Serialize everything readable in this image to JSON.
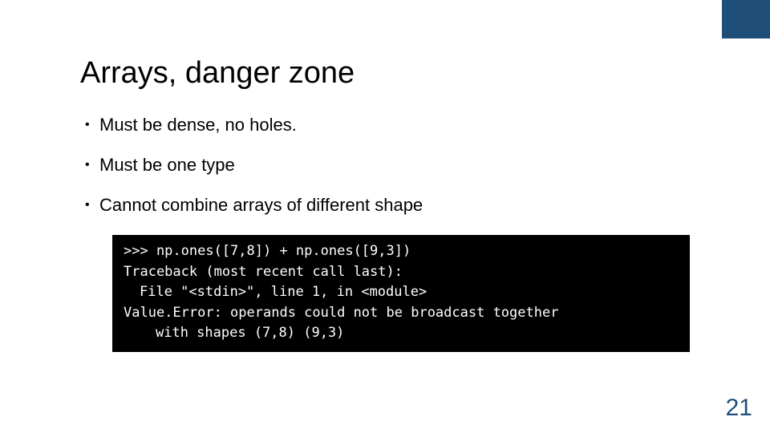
{
  "accent_color": "#1f4e79",
  "title": "Arrays, danger zone",
  "bullets": [
    "Must be dense, no holes.",
    "Must be one type",
    "Cannot combine arrays of different shape"
  ],
  "code": {
    "lines": [
      ">>> np.ones([7,8]) + np.ones([9,3])",
      "Traceback (most recent call last):",
      "File \"<stdin>\", line 1, in <module>",
      "Value.Error: operands could not be broadcast together",
      "with shapes (7,8) (9,3)"
    ]
  },
  "page_number": "21"
}
